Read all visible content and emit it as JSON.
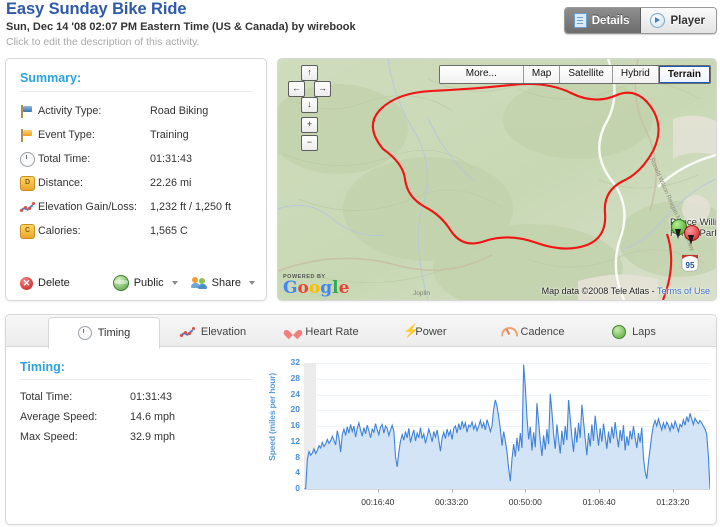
{
  "header": {
    "title": "Easy Sunday Bike Ride",
    "subtitle": "Sun, Dec 14 '08 02:07 PM Eastern Time (US & Canada) by wirebook",
    "description": "Click to edit the description of this activity.",
    "view_toggle": [
      {
        "label": "Details",
        "icon": "document-icon",
        "selected": true
      },
      {
        "label": "Player",
        "icon": "play-circle-icon",
        "selected": false
      }
    ]
  },
  "summary": {
    "title": "Summary:",
    "rows": [
      {
        "icon": "blue-flag-icon",
        "label": "Activity Type:",
        "value": "Road Biking"
      },
      {
        "icon": "orange-flag-icon",
        "label": "Event Type:",
        "value": "Training"
      },
      {
        "icon": "clock-icon",
        "label": "Total Time:",
        "value": "01:31:43"
      },
      {
        "icon": "distance-coin-icon",
        "label": "Distance:",
        "value": "22.26 mi"
      },
      {
        "icon": "elevation-icon",
        "label": "Elevation Gain/Loss:",
        "value": "1,232 ft / 1,250 ft"
      },
      {
        "icon": "calories-coin-icon",
        "label": "Calories:",
        "value": "1,565 C"
      }
    ],
    "actions": [
      {
        "label": "Delete",
        "icon": "delete-icon",
        "caret": false
      },
      {
        "label": "Public",
        "icon": "globe-icon",
        "caret": true
      },
      {
        "label": "Share",
        "icon": "people-icon",
        "caret": true
      }
    ]
  },
  "map": {
    "pan_controls": [
      "up-arrow-icon",
      "left-arrow-icon",
      "right-arrow-icon",
      "down-arrow-icon"
    ],
    "zoom_in": "+",
    "zoom_out": "−",
    "types": [
      {
        "label": "More...",
        "selected": false
      },
      {
        "label": "Map",
        "selected": false
      },
      {
        "label": "Satellite",
        "selected": false
      },
      {
        "label": "Hybrid",
        "selected": false
      },
      {
        "label": "Terrain",
        "selected": true
      }
    ],
    "poi_label": "Prince William Forest Park",
    "start_marker": "start-pin-green",
    "end_marker": "end-pin-red",
    "powered_by": "POWERED BY",
    "brand": "Google",
    "attribution": "Map data ©2008 Tele Atlas -",
    "terms_link": "Terms of Use",
    "route_color": "#f01414"
  },
  "tabs": [
    {
      "label": "Timing",
      "icon": "clock-icon",
      "selected": true
    },
    {
      "label": "Elevation",
      "icon": "elevation-icon",
      "selected": false
    },
    {
      "label": "Heart Rate",
      "icon": "heart-icon",
      "selected": false
    },
    {
      "label": "Power",
      "icon": "bolt-icon",
      "selected": false
    },
    {
      "label": "Cadence",
      "icon": "gauge-icon",
      "selected": false
    },
    {
      "label": "Laps",
      "icon": "lap-dot-icon",
      "selected": false
    }
  ],
  "timing": {
    "title": "Timing:",
    "rows": [
      {
        "label": "Total Time:",
        "value": "01:31:43"
      },
      {
        "label": "Average Speed:",
        "value": "14.6 mph"
      },
      {
        "label": "Max Speed:",
        "value": "32.9 mph"
      }
    ]
  },
  "chart_data": {
    "type": "area",
    "title": "",
    "xlabel": "",
    "ylabel": "Speed (miles per hour)",
    "ylim": [
      0,
      32
    ],
    "yticks": [
      0,
      4,
      8,
      12,
      16,
      20,
      24,
      28,
      32
    ],
    "xlim": [
      0,
      5503
    ],
    "xticks": [
      1000,
      2000,
      3000,
      4000,
      5000
    ],
    "xticklabels": [
      "00:16:40",
      "00:33:20",
      "00:50:00",
      "01:06:40",
      "01:23:20"
    ],
    "grid": true,
    "legend": null,
    "line_color": "#3f82d6",
    "fill_color": "#d4e4f7",
    "series": [
      {
        "name": "Speed",
        "values": [
          0,
          0,
          7.5,
          9.5,
          8.6,
          9.1,
          10.2,
          9.0,
          9.8,
          11.0,
          10.4,
          11.8,
          10.8,
          11.4,
          12.6,
          11.6,
          12.2,
          13.4,
          12.4,
          11.2,
          14.8,
          13.0,
          9.4,
          13.8,
          15.2,
          13.6,
          15.8,
          14.2,
          16.4,
          14.6,
          16.0,
          13.2,
          15.4,
          16.8,
          15.0,
          13.4,
          15.6,
          14.0,
          16.2,
          14.8,
          13.0,
          15.2,
          14.4,
          16.6,
          15.0,
          13.8,
          15.8,
          16.4,
          14.2,
          16.0,
          15.4,
          13.6,
          15.0,
          16.2,
          14.6,
          8.2,
          5.6,
          9.4,
          12.2,
          13.8,
          12.4,
          14.6,
          13.0,
          15.4,
          11.8,
          13.6,
          15.0,
          12.2,
          14.2,
          13.0,
          15.6,
          12.8,
          14.0,
          11.6,
          13.4,
          15.2,
          13.8,
          12.0,
          14.6,
          13.2,
          15.0,
          12.4,
          9.6,
          13.0,
          14.4,
          12.8,
          15.2,
          13.6,
          14.8,
          12.6,
          15.4,
          16.0,
          14.2,
          16.6,
          15.0,
          17.2,
          15.6,
          16.8,
          14.4,
          16.2,
          15.8,
          17.0,
          15.2,
          16.4,
          14.8,
          16.0,
          17.4,
          15.6,
          16.8,
          15.0,
          17.6,
          16.2,
          14.6,
          16.0,
          20.4,
          22.6,
          21.0,
          18.4,
          15.2,
          11.0,
          14.6,
          12.2,
          9.4,
          5.2,
          2.0,
          7.6,
          11.4,
          8.2,
          13.0,
          9.6,
          14.2,
          10.4,
          31.6,
          26.0,
          18.2,
          12.6,
          15.8,
          9.8,
          14.4,
          10.6,
          21.8,
          17.0,
          12.2,
          8.4,
          13.6,
          10.0,
          15.2,
          11.4,
          24.2,
          19.6,
          14.0,
          10.2,
          16.4,
          12.6,
          9.0,
          14.8,
          11.2,
          16.0,
          12.4,
          22.6,
          18.0,
          13.2,
          9.4,
          15.6,
          11.8,
          16.8,
          13.0,
          21.4,
          17.2,
          12.8,
          8.6,
          14.2,
          10.8,
          16.4,
          12.2,
          18.6,
          14.8,
          11.0,
          15.4,
          12.0,
          16.6,
          13.4,
          10.2,
          14.6,
          11.6,
          15.8,
          12.8,
          17.0,
          13.6,
          10.6,
          15.0,
          12.2,
          16.2,
          9.8,
          13.4,
          11.0,
          14.8,
          12.6,
          16.0,
          13.0,
          10.4,
          14.2,
          11.8,
          15.6,
          8.0,
          4.4,
          2.6,
          6.8,
          10.2,
          13.6,
          16.2,
          17.4,
          16.0,
          17.8,
          16.4,
          15.0,
          16.8,
          15.4,
          17.0,
          16.2,
          14.8,
          16.6,
          15.2,
          17.2,
          16.0,
          14.6,
          16.4,
          15.8,
          17.6,
          16.2,
          18.4,
          17.0,
          19.2,
          17.8,
          16.4,
          18.0,
          17.2,
          16.6,
          17.4,
          16.8,
          16.0,
          15.2,
          14.0,
          8.6,
          0
        ]
      }
    ]
  }
}
